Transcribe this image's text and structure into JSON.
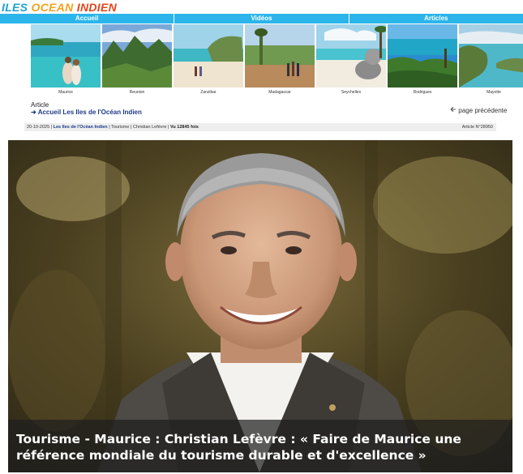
{
  "site": {
    "logo_part1": "ILES",
    "logo_part2": "OCEAN",
    "logo_part3": "INDIEN"
  },
  "nav": {
    "tabs": [
      "Accueil",
      "Vidéos",
      "Articles"
    ]
  },
  "gallery": {
    "items": [
      "Maurice",
      "Reunion",
      "Zanzibar",
      "Madagascar",
      "Seychelles",
      "Rodrigues",
      "Mayotte"
    ]
  },
  "article": {
    "label": "Article",
    "breadcrumb": "Accueil Les Iles de l'Océan Indien",
    "prev_page": "page précédente"
  },
  "meta": {
    "date": "20-10-2025",
    "category_link": "Les Iles de l'Océan Indien",
    "section": "Tourisme",
    "author": "Christian Lefèvre",
    "views": "Vu 12845 fois",
    "article_no": "Article N°28950"
  },
  "hero": {
    "title": "Tourisme - Maurice : Christian Lefèvre : « Faire de Maurice une référence mondiale du tourisme durable et d'excellence »"
  },
  "colors": {
    "nav_bg": "#2bb5ea",
    "link": "#1b3a8c",
    "caption_bg": "#1e1e1e"
  }
}
